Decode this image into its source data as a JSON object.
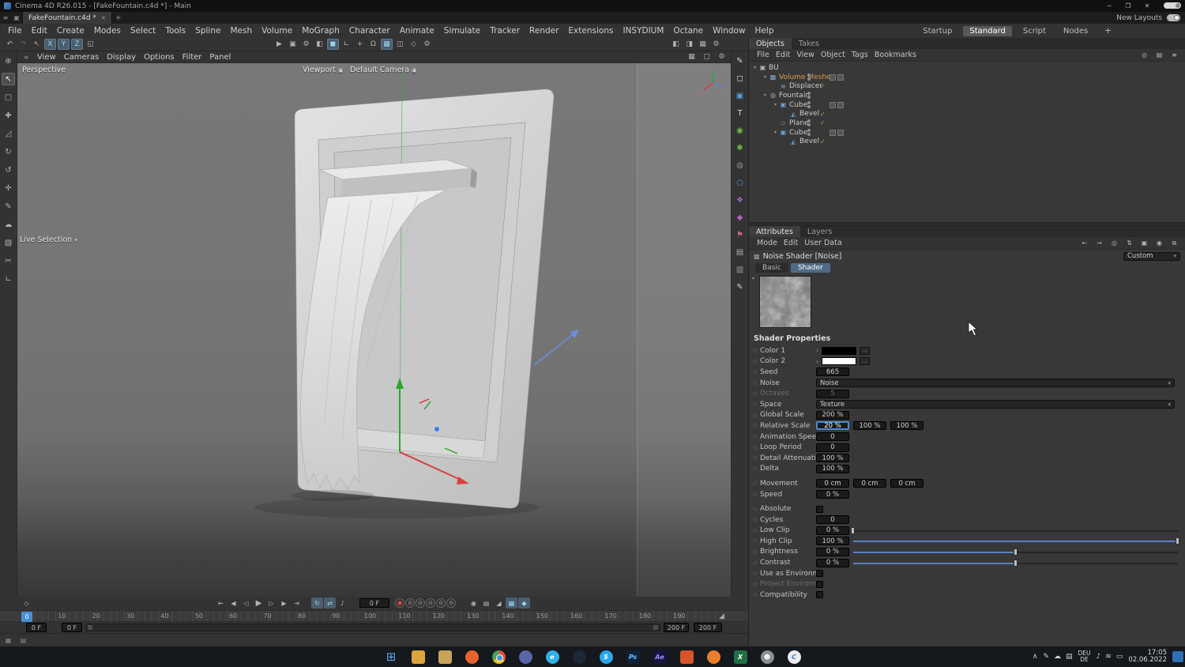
{
  "ui": {
    "dropdown_arrow": "▾",
    "expander": "▾",
    "check": "✓",
    "color_expand": "›",
    "picker_icon": "…",
    "dot": "○",
    "hud_icon": "▣",
    "menu_icon": "≡",
    "pin_icon": "▣",
    "diamond": "◇",
    "ramp": "◢",
    "tray_expand": "∧"
  },
  "titlebar": {
    "title": "Cinema 4D R26.015 - [FakeFountain.c4d *] - Main",
    "minimize": "─",
    "maximize": "❐",
    "close": "✕"
  },
  "tabbar": {
    "tab_label": "FakeFountain.c4d *",
    "tab_close": "✕",
    "new_tab": "+",
    "new_layouts": "New Layouts"
  },
  "menubar": {
    "items": [
      "File",
      "Edit",
      "Create",
      "Modes",
      "Select",
      "Tools",
      "Spline",
      "Mesh",
      "Volume",
      "MoGraph",
      "Character",
      "Animate",
      "Simulate",
      "Tracker",
      "Render",
      "Extensions",
      "INSYDIUM",
      "Octane",
      "Window",
      "Help"
    ],
    "layouts": [
      {
        "name": "layout-startup",
        "label": "Startup"
      },
      {
        "name": "layout-standard",
        "label": "Standard",
        "active": true
      },
      {
        "name": "layout-script",
        "label": "Script"
      },
      {
        "name": "layout-nodes",
        "label": "Nodes"
      }
    ],
    "add_layout": "+"
  },
  "toolbar": {
    "left": [
      {
        "name": "undo-icon",
        "glyph": "↶"
      },
      {
        "name": "redo-icon",
        "glyph": "↷",
        "disabled": true
      },
      {
        "name": "live-selection-icon",
        "glyph": "↖"
      },
      {
        "name": "lock-x-button",
        "glyph": "X",
        "active": true
      },
      {
        "name": "lock-y-button",
        "glyph": "Y",
        "active": true
      },
      {
        "name": "lock-z-button",
        "glyph": "Z",
        "active": true
      },
      {
        "name": "coordinate-system-icon",
        "glyph": "◱"
      }
    ],
    "center": [
      {
        "name": "render-view-icon",
        "glyph": "▶"
      },
      {
        "name": "render-region-icon",
        "glyph": "▣"
      },
      {
        "name": "render-settings-icon",
        "glyph": "⚙"
      },
      {
        "name": "interactive-render-icon",
        "glyph": "◧"
      },
      {
        "name": "model-mode-icon",
        "glyph": "◼",
        "active": true
      },
      {
        "name": "workplane-icon",
        "glyph": "∟"
      },
      {
        "name": "axis-center-icon",
        "glyph": "+"
      },
      {
        "name": "snap-icon",
        "glyph": "Ω"
      },
      {
        "name": "grid-snap-icon",
        "glyph": "▦",
        "active": true
      },
      {
        "name": "quantize-icon",
        "glyph": "◫"
      },
      {
        "name": "dynamic-guides-icon",
        "glyph": "◇"
      },
      {
        "name": "tool-settings-icon",
        "glyph": "⚙"
      }
    ],
    "right": [
      {
        "name": "layout-left-icon",
        "glyph": "◧"
      },
      {
        "name": "layout-right-icon",
        "glyph": "◨"
      },
      {
        "name": "viewport-layout-icon",
        "glyph": "▦"
      },
      {
        "name": "preferences-gear-icon",
        "glyph": "⚙"
      }
    ]
  },
  "left_palette": [
    {
      "name": "zoom-tool-icon",
      "glyph": "⊕"
    },
    {
      "name": "live-selection-tool-icon",
      "glyph": "↖",
      "active": true
    },
    {
      "name": "rectangle-selection-tool-icon",
      "glyph": "▢"
    },
    {
      "name": "move-tool-icon",
      "glyph": "✚"
    },
    {
      "name": "scale-tool-icon",
      "glyph": "◿"
    },
    {
      "name": "rotate-tool-icon",
      "glyph": "↻"
    },
    {
      "name": "last-tool-icon",
      "glyph": "↺"
    },
    {
      "name": "axis-tool-icon",
      "glyph": "✛"
    },
    {
      "name": "pen-tool-icon",
      "glyph": "✎"
    },
    {
      "name": "sculpt-tool-icon",
      "glyph": "☁"
    },
    {
      "name": "paint-tool-icon",
      "glyph": "▧"
    },
    {
      "name": "knife-tool-icon",
      "glyph": "✂"
    },
    {
      "name": "measure-tool-icon",
      "glyph": "∟"
    }
  ],
  "right_palette": [
    {
      "name": "spline-pen-icon",
      "glyph": "✎",
      "color": "#d8d8d8"
    },
    {
      "name": "cube-primitive-icon",
      "glyph": "◻",
      "color": "#d8d8d8"
    },
    {
      "name": "primitive-object-icon",
      "glyph": "▣",
      "color": "#5b9bd5"
    },
    {
      "name": "motext-icon",
      "glyph": "T",
      "color": "#d8d8d8"
    },
    {
      "name": "subdivision-surface-icon",
      "glyph": "◉",
      "color": "#72b944"
    },
    {
      "name": "mograph-cloner-icon",
      "glyph": "✱",
      "color": "#72b944"
    },
    {
      "name": "deformer-icon",
      "glyph": "◍",
      "color": "#8a8a8a"
    },
    {
      "name": "simulation-ring-icon",
      "glyph": "○",
      "color": "#5b9bd5"
    },
    {
      "name": "field-icon",
      "glyph": "❖",
      "color": "#a06fc8"
    },
    {
      "name": "volume-icon",
      "glyph": "◆",
      "color": "#b05fc0"
    },
    {
      "name": "tracker-flag-icon",
      "glyph": "⚑",
      "color": "#d0608d"
    },
    {
      "name": "scene-nodes-icon",
      "glyph": "▤",
      "color": "#aaaaaa"
    },
    {
      "name": "commander-icon",
      "glyph": "▥",
      "color": "#9a9a9a"
    },
    {
      "name": "sketch-pen-icon",
      "glyph": "✎",
      "color": "#cccccc"
    }
  ],
  "viewport": {
    "menus": [
      "View",
      "Cameras",
      "Display",
      "Options",
      "Filter",
      "Panel"
    ],
    "right_icons": [
      {
        "name": "vp-grid-icon",
        "glyph": "▦"
      },
      {
        "name": "vp-camera-icon",
        "glyph": "▢"
      },
      {
        "name": "vp-settings-icon",
        "glyph": "⚙"
      }
    ],
    "view_label": "Perspective",
    "hud_viewport": "Viewport",
    "hud_camera": "Default Camera",
    "tool_label": "Live Selection"
  },
  "object_manager": {
    "tabs": [
      {
        "name": "tab-objects",
        "label": "Objects",
        "active": true
      },
      {
        "name": "tab-takes",
        "label": "Takes"
      }
    ],
    "menus": [
      "File",
      "Edit",
      "View",
      "Object",
      "Tags",
      "Bookmarks"
    ],
    "right_icons": [
      {
        "name": "om-find-icon",
        "glyph": "◎"
      },
      {
        "name": "om-filter-icon",
        "glyph": "▤"
      },
      {
        "name": "om-menu-icon",
        "glyph": "≡"
      }
    ],
    "tree": [
      {
        "name": "object-row-bu",
        "label": "BU",
        "depth": 0,
        "expander": true,
        "glyph": "▣",
        "icolor": "#b8b8b8"
      },
      {
        "name": "object-row-volume-mesher",
        "label": "Volume Mesher",
        "depth": 1,
        "expander": true,
        "selected": true,
        "dots": true,
        "tags": true,
        "glyph": "▩",
        "icolor": "#7fa8d4"
      },
      {
        "name": "object-row-displacer",
        "label": "Displacer",
        "depth": 2,
        "check": true,
        "glyph": "≋",
        "icolor": "#7fa8d4"
      },
      {
        "name": "object-row-fountain",
        "label": "Fountain",
        "depth": 1,
        "expander": true,
        "dots": true,
        "glyph": "◎",
        "icolor": "#c0c0c0"
      },
      {
        "name": "object-row-cube",
        "label": "Cube",
        "depth": 2,
        "expander": true,
        "dots": true,
        "tags": true,
        "glyph": "▣",
        "icolor": "#6d9ed6"
      },
      {
        "name": "object-row-bevel",
        "label": "Bevel",
        "depth": 3,
        "check": true,
        "glyph": "◭",
        "icolor": "#6d9ed6"
      },
      {
        "name": "object-row-plane",
        "label": "Plane",
        "depth": 2,
        "check": true,
        "dots": true,
        "glyph": "▱",
        "icolor": "#6d9ed6"
      },
      {
        "name": "object-row-cube2",
        "label": "Cube",
        "depth": 2,
        "expander": true,
        "dots": true,
        "tags": true,
        "glyph": "▣",
        "icolor": "#6d9ed6"
      },
      {
        "name": "object-row-bevel2",
        "label": "Bevel",
        "depth": 3,
        "check": true,
        "glyph": "◭",
        "icolor": "#6d9ed6"
      }
    ]
  },
  "attributes": {
    "tabs": [
      {
        "name": "tab-attributes",
        "label": "Attributes",
        "active": true
      },
      {
        "name": "tab-layers",
        "label": "Layers"
      }
    ],
    "menus": [
      "Mode",
      "Edit",
      "User Data"
    ],
    "right_icons": [
      {
        "name": "at-back-icon",
        "glyph": "←"
      },
      {
        "name": "at-forward-icon",
        "glyph": "→"
      },
      {
        "name": "at-find-icon",
        "glyph": "◎"
      },
      {
        "name": "at-sync-icon",
        "glyph": "⇅"
      },
      {
        "name": "at-copy-icon",
        "glyph": "▣"
      },
      {
        "name": "at-target-icon",
        "glyph": "◉"
      },
      {
        "name": "at-popout-icon",
        "glyph": "⧉"
      }
    ],
    "object_title": "Noise Shader [Noise]",
    "preset": "Custom",
    "subtabs": [
      {
        "name": "subtab-basic",
        "label": "Basic"
      },
      {
        "name": "subtab-shader",
        "label": "Shader",
        "active": true
      }
    ],
    "section_title": "Shader Properties",
    "rows": [
      {
        "name": "prop-color-1",
        "label": "Color 1",
        "type": "color",
        "swatch": "#000000"
      },
      {
        "name": "prop-color-2",
        "label": "Color 2",
        "type": "color",
        "swatch": "#ffffff"
      },
      {
        "name": "prop-seed",
        "label": "Seed",
        "type": "field",
        "values": [
          "665"
        ]
      },
      {
        "name": "prop-noise",
        "label": "Noise",
        "type": "dropdown",
        "value": "Noise"
      },
      {
        "name": "prop-octaves",
        "label": "Octaves",
        "type": "field",
        "values": [
          "5"
        ],
        "disabled": true
      },
      {
        "name": "prop-space",
        "label": "Space",
        "type": "dropdown",
        "value": "Texture"
      },
      {
        "name": "prop-global-scale",
        "label": "Global Scale",
        "type": "field",
        "values": [
          "200 %"
        ]
      },
      {
        "name": "prop-relative-scale",
        "label": "Relative Scale",
        "type": "field",
        "values": [
          "20 %",
          "100 %",
          "100 %"
        ],
        "focused": 0
      },
      {
        "name": "prop-animation-speed",
        "label": "Animation Speed",
        "type": "field",
        "values": [
          "0"
        ]
      },
      {
        "name": "prop-loop-period",
        "label": "Loop Period",
        "type": "field",
        "values": [
          "0"
        ]
      },
      {
        "name": "prop-detail-attenuation",
        "label": "Detail Attenuation",
        "type": "field",
        "values": [
          "100 %"
        ]
      },
      {
        "name": "prop-delta",
        "label": "Delta",
        "type": "field",
        "values": [
          "100 %"
        ]
      },
      {
        "name": "prop-movement",
        "label": "Movement",
        "type": "field",
        "values": [
          "0 cm",
          "0 cm",
          "0 cm"
        ],
        "gap": true
      },
      {
        "name": "prop-speed",
        "label": "Speed",
        "type": "field",
        "values": [
          "0 %"
        ]
      },
      {
        "name": "prop-absolute",
        "label": "Absolute",
        "type": "check",
        "gap": true
      },
      {
        "name": "prop-cycles",
        "label": "Cycles",
        "type": "field",
        "values": [
          "0"
        ]
      },
      {
        "name": "prop-low-clip",
        "label": "Low Clip",
        "type": "slider",
        "values": [
          "0 %"
        ],
        "pos": 0
      },
      {
        "name": "prop-high-clip",
        "label": "High Clip",
        "type": "slider",
        "values": [
          "100 %"
        ],
        "pos": 100
      },
      {
        "name": "prop-brightness",
        "label": "Brightness",
        "type": "slider",
        "values": [
          "0 %"
        ],
        "pos": 50
      },
      {
        "name": "prop-contrast",
        "label": "Contrast",
        "type": "slider",
        "values": [
          "0 %"
        ],
        "pos": 50
      },
      {
        "name": "prop-use-as-environment",
        "label": "Use as Environment",
        "type": "check"
      },
      {
        "name": "prop-project-environment",
        "label": "Project Environment",
        "type": "check",
        "disabled": true
      },
      {
        "name": "prop-compatibility",
        "label": "Compatibility",
        "type": "check"
      }
    ]
  },
  "timeline": {
    "transport": [
      {
        "name": "goto-start-button",
        "glyph": "⇤"
      },
      {
        "name": "prev-key-button",
        "glyph": "◀"
      },
      {
        "name": "prev-frame-button",
        "glyph": "◁"
      },
      {
        "name": "play-button",
        "glyph": "▶",
        "big": true
      },
      {
        "name": "next-frame-button",
        "glyph": "▷"
      },
      {
        "name": "next-key-button",
        "glyph": "▶"
      },
      {
        "name": "goto-end-button",
        "glyph": "⇥"
      }
    ],
    "toggles": [
      {
        "name": "loop-mode-button",
        "glyph": "↻",
        "pressed": true
      },
      {
        "name": "pingpong-mode-button",
        "glyph": "⇄",
        "pressed": true
      },
      {
        "name": "sound-button",
        "glyph": "♪"
      }
    ],
    "current_frame": "0 F",
    "record": [
      {
        "name": "record-keyframe-button",
        "glyph": "●",
        "color": "#d84444"
      },
      {
        "name": "record-position-button",
        "glyph": "⊙"
      },
      {
        "name": "record-scale-button",
        "glyph": "⊙"
      },
      {
        "name": "record-rotation-button",
        "glyph": "⊙"
      },
      {
        "name": "record-parameter-button",
        "glyph": "⊙"
      },
      {
        "name": "record-pla-button",
        "glyph": "⊙"
      }
    ],
    "extra": [
      {
        "name": "autokey-button",
        "glyph": "◉"
      },
      {
        "name": "keyframe-presets-button",
        "glyph": "▤"
      },
      {
        "name": "fcurve-button",
        "glyph": "◢"
      },
      {
        "name": "snap-frame-button",
        "glyph": "▦",
        "pressed": true
      },
      {
        "name": "interpolation-button",
        "glyph": "◆",
        "pressed": true
      }
    ],
    "playhead": "0",
    "ticks": [
      {
        "v": "10",
        "pct": 4.9
      },
      {
        "v": "20",
        "pct": 9.8
      },
      {
        "v": "30",
        "pct": 14.7
      },
      {
        "v": "40",
        "pct": 19.6
      },
      {
        "v": "50",
        "pct": 24.5
      },
      {
        "v": "60",
        "pct": 29.4
      },
      {
        "v": "70",
        "pct": 34.3
      },
      {
        "v": "80",
        "pct": 39.2
      },
      {
        "v": "90",
        "pct": 44.1
      },
      {
        "v": "100",
        "pct": 49
      },
      {
        "v": "110",
        "pct": 53.9
      },
      {
        "v": "120",
        "pct": 58.8
      },
      {
        "v": "130",
        "pct": 63.7
      },
      {
        "v": "140",
        "pct": 68.7
      },
      {
        "v": "150",
        "pct": 73.6
      },
      {
        "v": "160",
        "pct": 78.5
      },
      {
        "v": "170",
        "pct": 83.4
      },
      {
        "v": "180",
        "pct": 88.3
      },
      {
        "v": "190",
        "pct": 93.2
      }
    ],
    "range_start": "0 F",
    "range_current": "0 F",
    "range_end": "200 F",
    "doc_end": "200 F"
  },
  "statusbar": {
    "icons": [
      {
        "name": "status-grid-icon",
        "glyph": "▦"
      },
      {
        "name": "status-layers-icon",
        "glyph": "▤"
      }
    ]
  },
  "taskbar": {
    "apps": [
      {
        "name": "taskbar-start-button",
        "letter": "⊞",
        "cls": "start"
      },
      {
        "name": "taskbar-file-explorer",
        "bg": "#dba43d"
      },
      {
        "name": "taskbar-folder",
        "bg": "#c9a35a"
      },
      {
        "name": "taskbar-firefox",
        "bg": "#e8632c",
        "round": true
      },
      {
        "name": "taskbar-chrome",
        "cls": "chrome",
        "round": true
      },
      {
        "name": "taskbar-discord",
        "bg": "#5865a8",
        "round": true
      },
      {
        "name": "taskbar-edge",
        "bg": "#30b0e8",
        "round": true,
        "letter": "e"
      },
      {
        "name": "taskbar-steam",
        "bg": "#1b2838",
        "round": true
      },
      {
        "name": "taskbar-skype",
        "bg": "#28a8ea",
        "round": true,
        "letter": "S"
      },
      {
        "name": "taskbar-photoshop",
        "bg": "#0d2237",
        "letter": "Ps",
        "fg": "#6fc1ff"
      },
      {
        "name": "taskbar-aftereffects",
        "bg": "#1a1440",
        "letter": "Ae",
        "fg": "#9f93ff"
      },
      {
        "name": "taskbar-app-orange",
        "bg": "#d8542a"
      },
      {
        "name": "taskbar-firefox-dev",
        "bg": "#e87f2c",
        "round": true
      },
      {
        "name": "taskbar-excel",
        "bg": "#1f7145",
        "letter": "X"
      },
      {
        "name": "taskbar-contacts",
        "bg": "#8a8f96",
        "round": true,
        "letter": "☻"
      },
      {
        "name": "taskbar-cinema4d",
        "bg": "#ececec",
        "round": true,
        "letter": "C",
        "fg": "#3a7bd4"
      }
    ],
    "tray": {
      "icons": [
        {
          "name": "tray-pen-icon",
          "glyph": "✎"
        },
        {
          "name": "tray-cloud-icon",
          "glyph": "☁"
        },
        {
          "name": "tray-window-icon",
          "glyph": "▤"
        }
      ],
      "lang_line1": "DEU",
      "lang_line2": "DE",
      "icons2": [
        {
          "name": "volume-icon",
          "glyph": "♪"
        },
        {
          "name": "network-icon",
          "glyph": "≋"
        },
        {
          "name": "action-center-icon",
          "glyph": "▭"
        }
      ],
      "time": "17:05",
      "date": "02.06.2022"
    }
  }
}
